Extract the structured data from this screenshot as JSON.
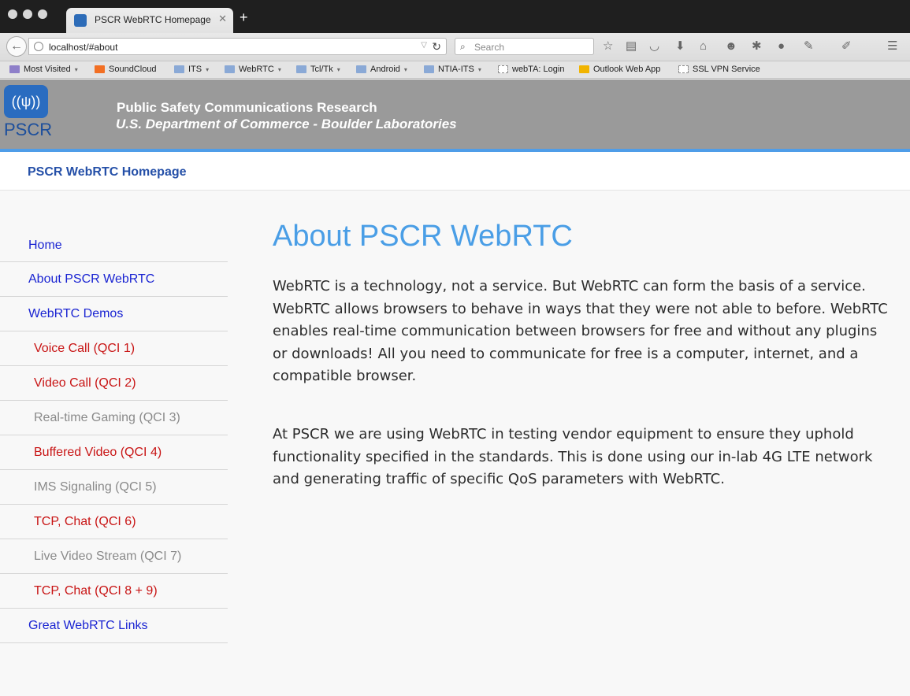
{
  "browser": {
    "tab_title": "PSCR WebRTC Homepage",
    "url": "localhost/#about",
    "search_placeholder": "Search",
    "bookmarks": [
      {
        "label": "Most Visited",
        "icon": "most-visited-icon",
        "dropdown": true
      },
      {
        "label": "SoundCloud",
        "icon": "soundcloud-icon",
        "dropdown": false
      },
      {
        "label": "ITS",
        "icon": "folder-icon",
        "dropdown": true
      },
      {
        "label": "WebRTC",
        "icon": "folder-icon",
        "dropdown": true
      },
      {
        "label": "Tcl/Tk",
        "icon": "folder-icon",
        "dropdown": true
      },
      {
        "label": "Android",
        "icon": "folder-icon",
        "dropdown": true
      },
      {
        "label": "NTIA-ITS",
        "icon": "folder-icon",
        "dropdown": true
      },
      {
        "label": "webTA: Login",
        "icon": "page-icon",
        "dropdown": false
      },
      {
        "label": "Outlook Web App",
        "icon": "outlook-icon",
        "dropdown": false
      },
      {
        "label": "SSL VPN Service",
        "icon": "page-icon",
        "dropdown": false
      }
    ]
  },
  "banner": {
    "logo_text": "PSCR",
    "title": "Public Safety Communications Research",
    "subtitle": "U.S. Department of Commerce - Boulder Laboratories"
  },
  "site_nav": {
    "brand": "PSCR WebRTC Homepage"
  },
  "sidebar": {
    "items": [
      {
        "label": "Home",
        "kind": "top"
      },
      {
        "label": "About PSCR WebRTC",
        "kind": "top"
      },
      {
        "label": "WebRTC Demos",
        "kind": "top"
      },
      {
        "label": "Voice Call (QCI 1)",
        "kind": "active"
      },
      {
        "label": "Video Call (QCI 2)",
        "kind": "active"
      },
      {
        "label": "Real-time Gaming (QCI 3)",
        "kind": "inactive"
      },
      {
        "label": "Buffered Video (QCI 4)",
        "kind": "active"
      },
      {
        "label": "IMS Signaling (QCI 5)",
        "kind": "inactive"
      },
      {
        "label": "TCP, Chat (QCI 6)",
        "kind": "active"
      },
      {
        "label": "Live Video Stream (QCI 7)",
        "kind": "inactive"
      },
      {
        "label": "TCP, Chat (QCI 8 + 9)",
        "kind": "active"
      },
      {
        "label": "Great WebRTC Links",
        "kind": "top"
      }
    ]
  },
  "main": {
    "heading": "About PSCR WebRTC",
    "paragraphs": [
      "WebRTC is a technology, not a service. But WebRTC can form the basis of a service. WebRTC allows browsers to behave in ways that they were not able to before. WebRTC enables real-time communication between browsers for free and without any plugins or downloads! All you need to communicate for free is a computer, internet, and a compatible browser.",
      "At PSCR we are using WebRTC in testing vendor equipment to ensure they uphold functionality specified in the standards. This is done using our in-lab 4G LTE network and generating traffic of specific QoS parameters with WebRTC."
    ]
  },
  "colors": {
    "banner_bg": "#9a9a9a",
    "banner_stripe": "#4f9de8",
    "heading": "#4a9ee6",
    "nav_link": "#1a24d2",
    "active_demo": "#c81414",
    "inactive_demo": "#8a8a8a"
  }
}
